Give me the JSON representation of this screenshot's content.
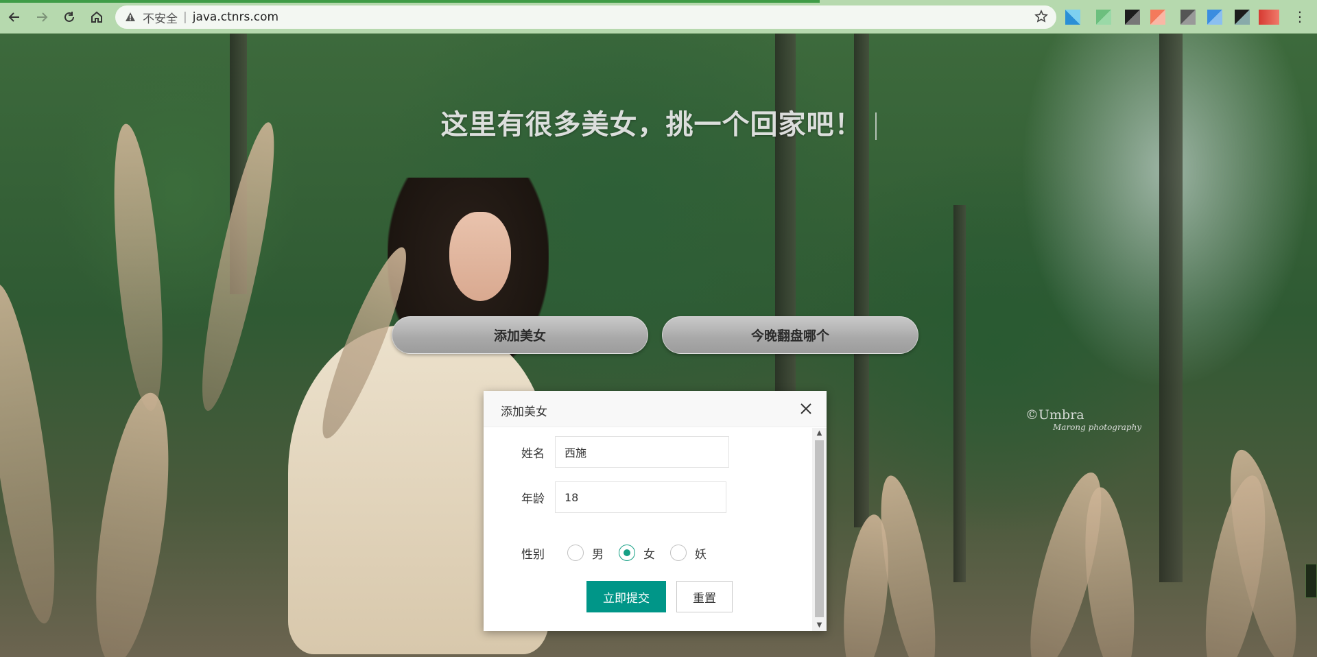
{
  "browser": {
    "back_label": "←",
    "forward_label": "→",
    "reload_label": "↻",
    "home_label": "⌂",
    "security_text": "不安全",
    "separator": "|",
    "url": "java.ctnrs.com",
    "bookmark_icon": "star-icon",
    "menu_label": "⋮",
    "colors": {
      "toolbar": "#b6d9ae",
      "progress": "#3f9c47"
    }
  },
  "hero": {
    "title": "这里有很多美女，挑一个回家吧！",
    "watermark": "©Umbra",
    "watermark_sub": "Marong photography"
  },
  "actions": {
    "add_label": "添加美女",
    "pick_label": "今晚翻盘哪个"
  },
  "dialog": {
    "title": "添加美女",
    "close_icon": "close-icon",
    "fields": {
      "name_label": "姓名",
      "name_value": "西施",
      "age_label": "年龄",
      "age_value": "18",
      "gender_label": "性别"
    },
    "gender_options": [
      {
        "label": "男",
        "checked": false
      },
      {
        "label": "女",
        "checked": true
      },
      {
        "label": "妖",
        "checked": false
      }
    ],
    "submit_label": "立即提交",
    "reset_label": "重置",
    "colors": {
      "primary": "#009688",
      "radio_checked": "#16a085"
    }
  }
}
